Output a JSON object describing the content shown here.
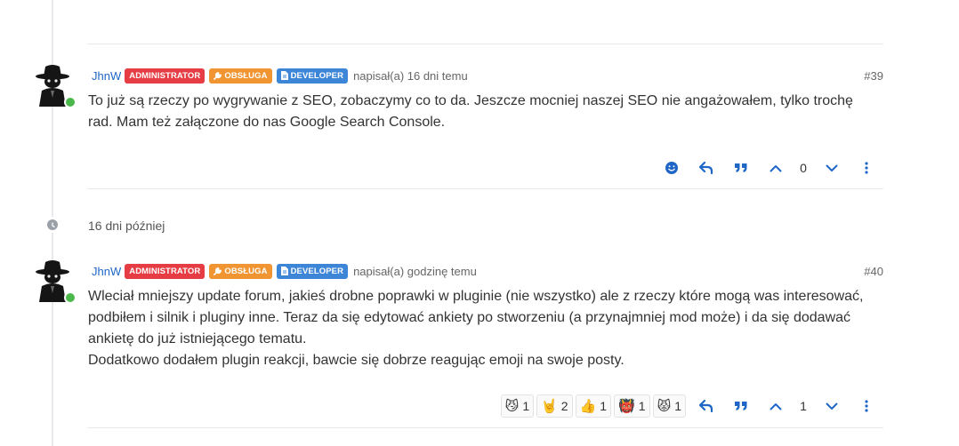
{
  "posts": [
    {
      "author": "JhnW",
      "badges": [
        "ADMINISTRATOR",
        "OBSŁUGA",
        "DEVELOPER"
      ],
      "posted_text": "napisał(a) 16 dni temu",
      "number": "#39",
      "content_lines": [
        "To już są rzeczy po wygrywanie z SEO, zobaczymy co to da. Jeszcze mocniej naszej SEO nie angażowałem, tylko trochę rad. Mam też załączone do nas Google Search Console."
      ],
      "votes": "0"
    },
    {
      "author": "JhnW",
      "badges": [
        "ADMINISTRATOR",
        "OBSŁUGA",
        "DEVELOPER"
      ],
      "posted_text": "napisał(a) godzinę temu",
      "number": "#40",
      "content_lines": [
        "Wleciał mniejszy update forum, jakieś drobne poprawki w pluginie (nie wszystko) ale z rzeczy które mogą was interesować, podbiłem i silnik i pluginy inne. Teraz da się edytować ankiety po stworzeniu (a przynajmniej mod może) i da się dodawać ankietę do już istniejącego tematu.",
        "Dodatkowo dodałem plugin reakcji, bawcie się dobrze reagując emoji na swoje posty."
      ],
      "reactions": [
        {
          "emoji": "😼",
          "count": "1"
        },
        {
          "emoji": "🤘",
          "count": "2"
        },
        {
          "emoji": "👍",
          "count": "1"
        },
        {
          "emoji": "👹",
          "count": "1"
        },
        {
          "emoji": "😾",
          "count": "1"
        }
      ],
      "votes": "1"
    }
  ],
  "gap_label": "16 dni później",
  "colors": {
    "accent": "#1f66c7",
    "admin_badge": "#e63d44",
    "support_badge": "#f19533",
    "developer_badge": "#3d86d7",
    "online": "#4bb84b"
  },
  "icons": [
    "smiley-icon",
    "reply-icon",
    "quote-icon",
    "upvote-icon",
    "downvote-icon",
    "more-icon",
    "clock-icon",
    "wrench-icon",
    "file-icon"
  ]
}
